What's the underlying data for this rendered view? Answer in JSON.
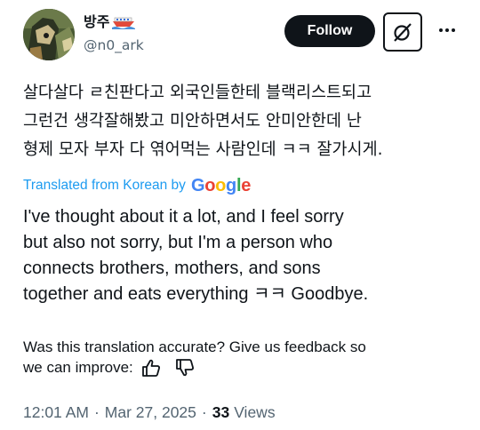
{
  "author": {
    "display_name": "방주",
    "handle": "@n0_ark",
    "avatar_icon": "avatar-image",
    "badge_icon": "boat-emoji"
  },
  "actions": {
    "follow_label": "Follow",
    "grok_icon": "grok-icon",
    "more_icon": "more-icon"
  },
  "tweet": {
    "lines": [
      "살다살다 ㄹ친판다고 외국인들한테 블랙리스트되고",
      "그런건 생각잘해봤고 미안하면서도 안미안한데 난",
      "형제 모자 부자 다 엮어먹는 사람인데 ㅋㅋ 잘가시게."
    ]
  },
  "translation": {
    "source_label": "Translated from Korean by",
    "provider": "Google",
    "lines": [
      "I've thought about it a lot, and I feel sorry",
      "but also not sorry, but I'm a person who",
      "connects brothers, mothers, and sons",
      "together and eats everything ㅋㅋ Goodbye."
    ]
  },
  "feedback": {
    "line1": "Was this translation accurate? Give us feedback so",
    "line2": "we can improve:",
    "thumbs_up_icon": "thumbs-up-icon",
    "thumbs_down_icon": "thumbs-down-icon"
  },
  "meta": {
    "time": "12:01 AM",
    "separator": "·",
    "date": "Mar 27, 2025",
    "views_count": "33",
    "views_label": "Views"
  },
  "colors": {
    "link_blue": "#1d9bf0",
    "secondary_text": "#536471",
    "primary_text": "#0f1419",
    "google_blue": "#4285F4",
    "google_red": "#EA4335",
    "google_yellow": "#FBBC05",
    "google_green": "#34A853"
  }
}
